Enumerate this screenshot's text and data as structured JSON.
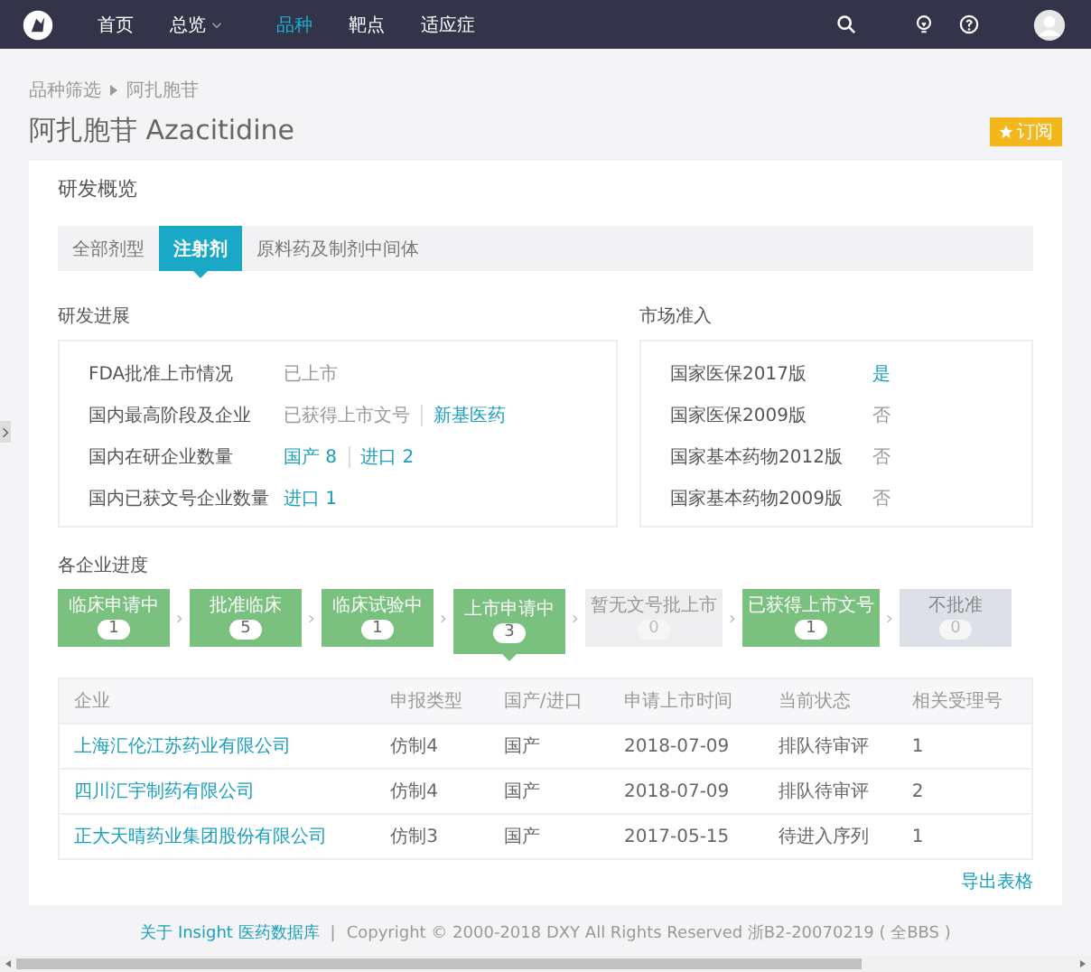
{
  "nav": {
    "items": [
      {
        "label": "首页",
        "selected": false,
        "has_menu": false
      },
      {
        "label": "总览",
        "selected": false,
        "has_menu": true
      },
      {
        "label": "品种",
        "selected": true,
        "has_menu": false
      },
      {
        "label": "靶点",
        "selected": false,
        "has_menu": false
      },
      {
        "label": "适应症",
        "selected": false,
        "has_menu": false
      }
    ]
  },
  "breadcrumb": [
    "品种筛选",
    "阿扎胞苷"
  ],
  "title": "阿扎胞苷 Azacitidine",
  "subscribe_button": "订阅",
  "overview": {
    "title": "研发概览",
    "tabs": [
      {
        "label": "全部剂型",
        "selected": false
      },
      {
        "label": "注射剂",
        "selected": true
      },
      {
        "label": "原料药及制剂中间体",
        "selected": false
      }
    ],
    "progress": {
      "title": "研发进展",
      "rows": [
        {
          "label": "FDA批准上市情况",
          "values": [
            {
              "text": "已上市",
              "link": false
            }
          ]
        },
        {
          "label": "国内最高阶段及企业",
          "values": [
            {
              "text": "已获得上市文号",
              "link": false
            },
            {
              "text": "新基医药",
              "link": true
            }
          ]
        },
        {
          "label": "国内在研企业数量",
          "values": [
            {
              "text": "国产 8",
              "link": true
            },
            {
              "text": "进口 2",
              "link": true
            }
          ]
        },
        {
          "label": "国内已获文号企业数量",
          "values": [
            {
              "text": "进口 1",
              "link": true
            }
          ]
        }
      ]
    },
    "market": {
      "title": "市场准入",
      "rows": [
        {
          "label": "国家医保2017版",
          "value": "是",
          "link": true
        },
        {
          "label": "国家医保2009版",
          "value": "否",
          "link": false
        },
        {
          "label": "国家基本药物2012版",
          "value": "否",
          "link": false
        },
        {
          "label": "国家基本药物2009版",
          "value": "否",
          "link": false
        }
      ]
    }
  },
  "companies": {
    "title": "各企业进度",
    "stages": [
      {
        "label": "临床申请中",
        "count": "1",
        "kind": "done",
        "selected": false
      },
      {
        "label": "批准临床",
        "count": "5",
        "kind": "done",
        "selected": false
      },
      {
        "label": "临床试验中",
        "count": "1",
        "kind": "done",
        "selected": false
      },
      {
        "label": "上市申请中",
        "count": "3",
        "kind": "done",
        "selected": true
      },
      {
        "label": "暂无文号批上市",
        "count": "0",
        "kind": "empty",
        "selected": false
      },
      {
        "label": "已获得上市文号",
        "count": "1",
        "kind": "done",
        "selected": false
      },
      {
        "label": "不批准",
        "count": "0",
        "kind": "rejected",
        "selected": false
      }
    ],
    "table": {
      "columns": [
        "企业",
        "申报类型",
        "国产/进口",
        "申请上市时间",
        "当前状态",
        "相关受理号"
      ],
      "rows": [
        [
          "上海汇伦江苏药业有限公司",
          "仿制4",
          "国产",
          "2018-07-09",
          "排队待审评",
          "1"
        ],
        [
          "四川汇宇制药有限公司",
          "仿制4",
          "国产",
          "2018-07-09",
          "排队待审评",
          "2"
        ],
        [
          "正大天晴药业集团股份有限公司",
          "仿制3",
          "国产",
          "2017-05-15",
          "待进入序列",
          "1"
        ]
      ]
    },
    "export_link": "导出表格"
  },
  "footer": {
    "link": "关于 Insight 医药数据库",
    "separator": "|",
    "text": "Copyright © 2000-2018 DXY All Rights Reserved 浙B2-20070219 ( 全BBS )"
  }
}
